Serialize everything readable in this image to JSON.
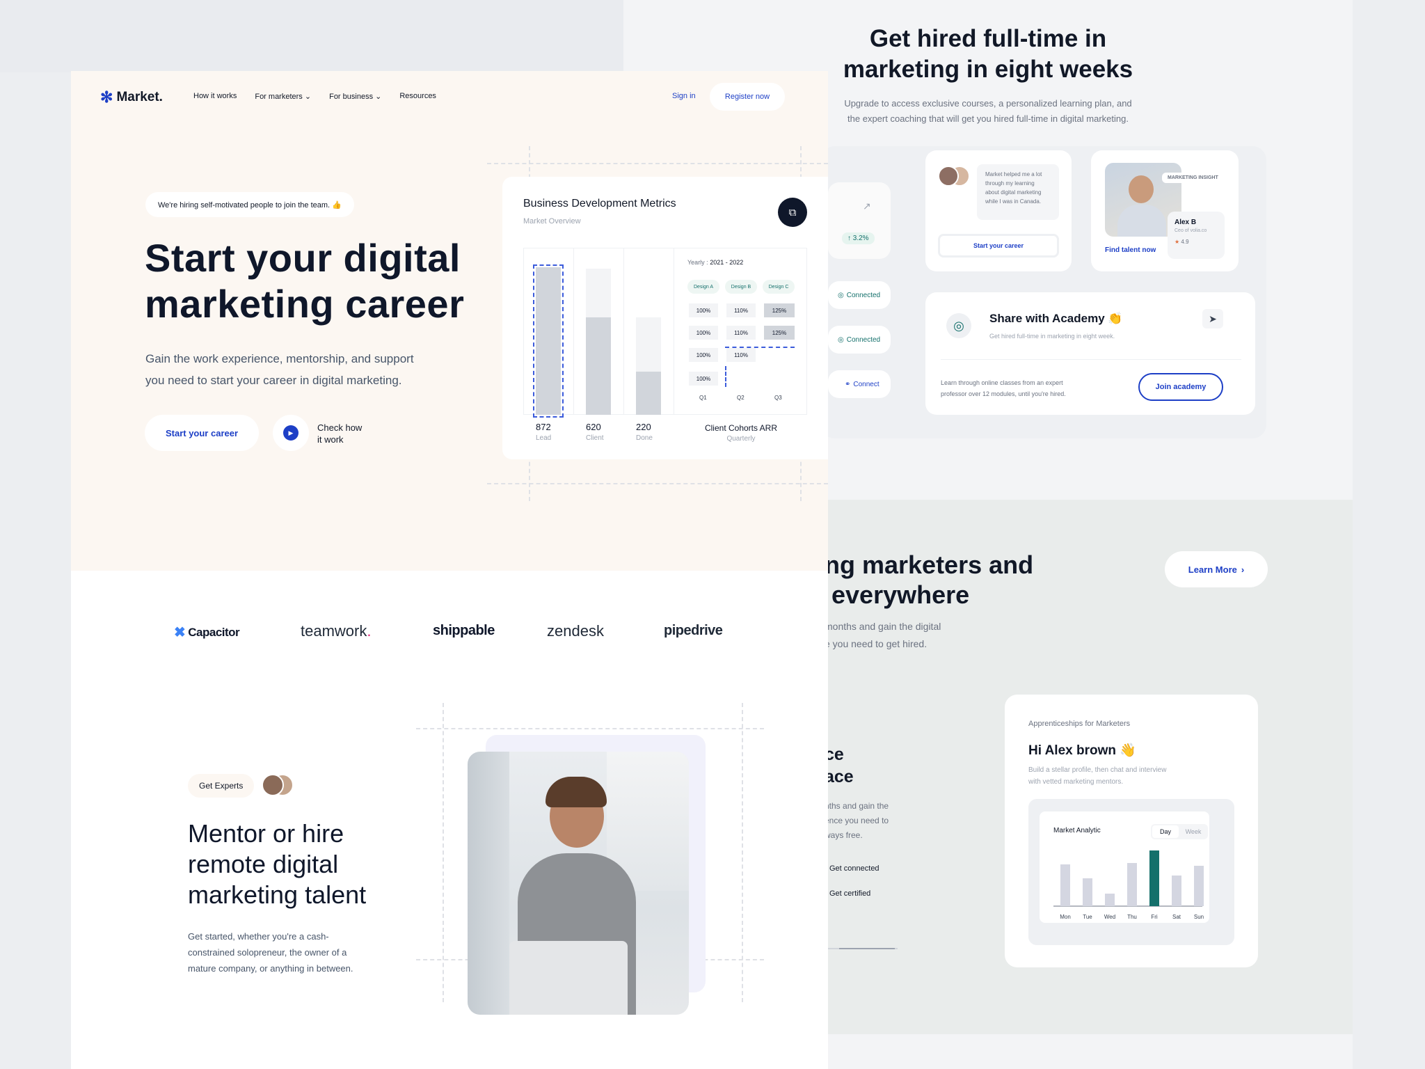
{
  "colors": {
    "accent": "#1d3fc6",
    "teal": "#14706b",
    "cream": "#fcf7f2",
    "dark": "#0f172a",
    "star": "#e0703f"
  },
  "nav": {
    "logo": "Market.",
    "items": [
      "How it works",
      "For marketers",
      "For business",
      "Resources"
    ],
    "signin": "Sign in",
    "register": "Register now"
  },
  "hero": {
    "badge": "We're hiring self-motivated people to join the team. 👍",
    "title_line1": "Start your digital",
    "title_line2": "marketing career",
    "subtitle_line1": "Gain the work experience, mentorship, and support",
    "subtitle_line2": "you need to start your career in digital marketing.",
    "cta": "Start your career",
    "check_line1": "Check how",
    "check_line2": "it work"
  },
  "bdm": {
    "title": "Business Development Metrics",
    "subtitle": "Market Overview",
    "year_label": "Yearly :",
    "year_value": "2021 - 2022",
    "designs": [
      "Design A",
      "Design B",
      "Design C"
    ],
    "col_a": [
      "100%",
      "100%",
      "100%",
      "100%"
    ],
    "col_b": [
      "110%",
      "110%",
      "110%"
    ],
    "col_c": [
      "125%",
      "125%"
    ],
    "quarters": [
      "Q1",
      "Q2",
      "Q3"
    ],
    "stats": [
      {
        "value": "872",
        "label": "Lead"
      },
      {
        "value": "620",
        "label": "Client"
      },
      {
        "value": "220",
        "label": "Done"
      }
    ],
    "cohort_title": "Client Cohorts ARR",
    "cohort_sub": "Quarterly"
  },
  "logos": [
    "Capacitor",
    "teamwork",
    "shippable",
    "zendesk",
    "pipedrive"
  ],
  "mentor": {
    "badge": "Get Experts",
    "title_line1": "Mentor or hire",
    "title_line2": "remote digital",
    "title_line3": "marketing talent",
    "desc_line1": "Get started, whether you're a cash-",
    "desc_line2": "constrained solopreneur, the owner of a",
    "desc_line3": "mature company, or anything in between."
  },
  "hired": {
    "title_line1": "Get hired full-time in",
    "title_line2": "marketing in eight weeks",
    "desc_line1": "Upgrade to access exclusive courses, a personalized learning plan, and",
    "desc_line2": "the expert coaching that will get you hired full-time in digital marketing."
  },
  "left_partial": {
    "growth": "↑ 3.2%",
    "connected1": "Connected",
    "connected2": "Connected",
    "connect": "Connect"
  },
  "testimonial": {
    "line1": "Market helped me a lot",
    "line2": "through my learning",
    "line3": "about digital marketing",
    "line4": "while I was in Canada.",
    "button": "Start your career"
  },
  "talent": {
    "tag": "MARKETING INSIGHT",
    "name": "Alex B",
    "role": "Ceo of volia.co",
    "rating": "4.9",
    "link": "Find talent now"
  },
  "academy": {
    "title": "Share with Academy 👏",
    "subtitle": "Get hired full-time in marketing in eight week.",
    "desc_line1": "Learn through online classes from an expert",
    "desc_line2": "professor over 12 modules, until you're hired.",
    "button": "Join academy"
  },
  "section3": {
    "title_line1": "ng marketers and",
    "title_line2": "everywhere",
    "desc_line1": "months and gain the digital",
    "desc_line2": "e you need to get hired.",
    "learn_more": "Learn More"
  },
  "partial2": {
    "title_line1": "ce",
    "title_line2": "ace",
    "desc_line1": "nths and gain the",
    "desc_line2": "ence you need to",
    "desc_line3": "ways free.",
    "item1": "Get connected",
    "item2": "Get certified"
  },
  "apprentice": {
    "label": "Apprenticeships for Marketers",
    "greeting": "Hi Alex brown 👋",
    "desc_line1": "Build a stellar profile, then chat and interview",
    "desc_line2": "with vetted marketing mentors."
  },
  "chart_data": {
    "type": "bar",
    "title": "Market Analytic",
    "tabs": [
      "Day",
      "Week"
    ],
    "selected_tab": "Day",
    "categories": [
      "Mon",
      "Tue",
      "Wed",
      "Thu",
      "Fri",
      "Sat",
      "Sun"
    ],
    "values": [
      60,
      40,
      18,
      62,
      80,
      44,
      58
    ],
    "highlight_index": 4
  }
}
